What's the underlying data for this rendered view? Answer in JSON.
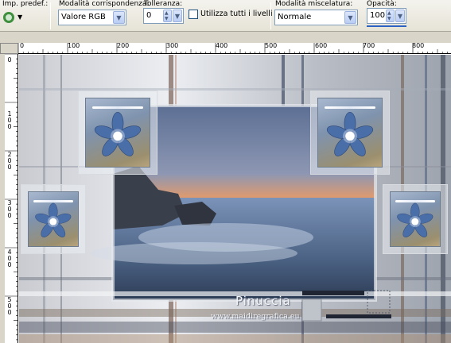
{
  "toolbar": {
    "preset_label": "Imp. predef.:",
    "match_mode_label": "Modalità corrispondenza:",
    "match_mode_value": "Valore RGB",
    "tolerance_label": "Tolleranza:",
    "tolerance_value": "0",
    "use_all_layers_label": "Utilizza tutti i livelli",
    "use_all_layers_checked": false,
    "blend_mode_label": "Modalità miscelatura:",
    "blend_mode_value": "Normale",
    "opacity_label": "Opacità:",
    "opacity_value": "100"
  },
  "rulers": {
    "horizontal": [
      "0",
      "100",
      "200",
      "300",
      "400",
      "500",
      "600",
      "700",
      "800"
    ],
    "vertical": [
      "0",
      "1 0 0",
      "2 0 0",
      "3 0 0",
      "4 0 0",
      "5 0 0"
    ]
  },
  "canvas": {
    "watermark_title": "Pinuccia",
    "watermark_url": "www.maidiregrafica.eu"
  },
  "icons": {
    "preset": "preset-icon",
    "dropdown": "chevron-down-icon",
    "spinner": "spinner-arrows-icon"
  },
  "colors": {
    "toolbar_bg": "#ece9d8",
    "field_border": "#7f9db9",
    "dropdown_button": "#c1d3fb",
    "opacity_accent": "#2c62c4",
    "canvas_bg": "#dcdde2",
    "tile_blue": "#7f93ae"
  }
}
